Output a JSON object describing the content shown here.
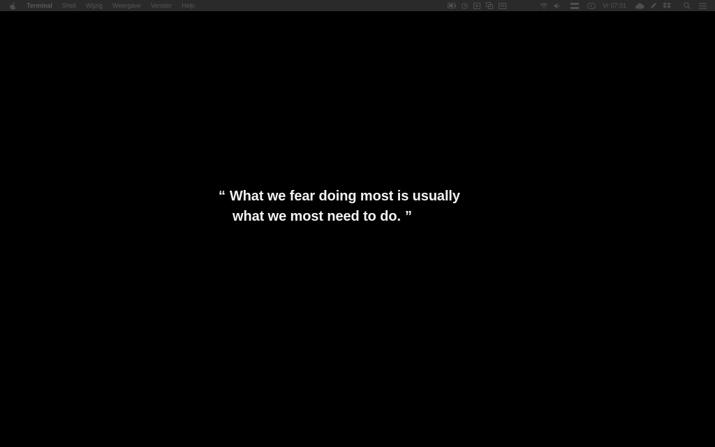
{
  "menubar": {
    "app_name": "Terminal",
    "items": [
      {
        "label": "Shell"
      },
      {
        "label": "Wijzig"
      },
      {
        "label": "Weergave"
      },
      {
        "label": "Venster"
      },
      {
        "label": "Help"
      }
    ],
    "clock": "Vr 07:01",
    "status_icons": [
      "battery-icon",
      "clock-icon",
      "app-icon",
      "copy-icon",
      "display-icon",
      "wifi-icon",
      "volume-icon",
      "flag-icon",
      "time-machine-icon",
      "cloud-icon",
      "pen-icon",
      "dropbox-icon",
      "search-icon",
      "list-icon"
    ]
  },
  "screen": {
    "quote": {
      "open_mark": "“",
      "line1": "What we fear doing most is usually",
      "line2": "what we most need to do.",
      "close_mark": "”"
    }
  }
}
